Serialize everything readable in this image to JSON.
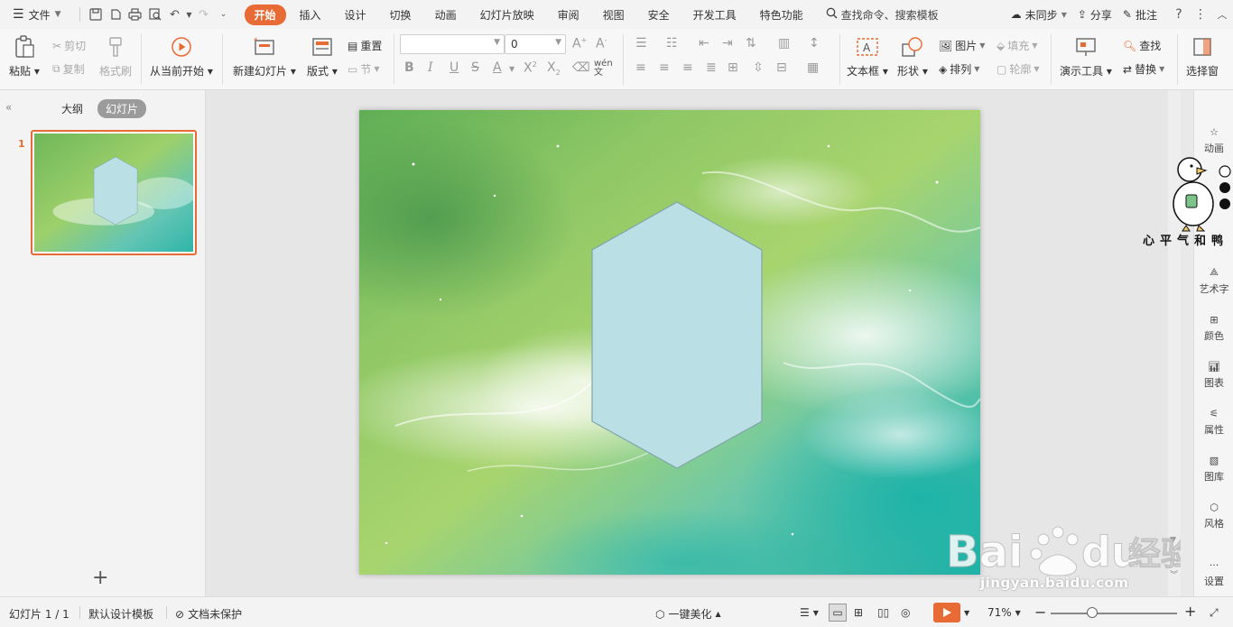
{
  "menu": {
    "file_label": "文件",
    "tabs": [
      "开始",
      "插入",
      "设计",
      "切换",
      "动画",
      "幻灯片放映",
      "审阅",
      "视图",
      "安全",
      "开发工具",
      "特色功能"
    ],
    "active_tab": "开始",
    "search_label": "查找命令、搜索模板",
    "sync_label": "未同步",
    "share_label": "分享",
    "comment_label": "批注",
    "help_label": "?"
  },
  "ribbon": {
    "paste": "粘贴",
    "cut": "剪切",
    "copy": "复制",
    "format_painter": "格式刷",
    "from_current": "从当前开始",
    "new_slide": "新建幻灯片",
    "layout": "版式",
    "reset": "重置",
    "section": "节",
    "font_name": "",
    "font_size": "0",
    "textbox": "文本框",
    "shape": "形状",
    "picture": "图片",
    "fill": "填充",
    "arrange": "排列",
    "outline": "轮廓",
    "present_tools": "演示工具",
    "find": "查找",
    "replace": "替换",
    "select_pane": "选择窗"
  },
  "left_panel": {
    "tab_outline": "大纲",
    "tab_slides": "幻灯片",
    "slide_number": "1",
    "add_symbol": "+"
  },
  "right_panel": {
    "items": [
      "动画",
      "艺术字",
      "颜色",
      "图表",
      "属性",
      "图库",
      "风格",
      "设置"
    ]
  },
  "watermarks": {
    "duck_text": "心平气和鸭",
    "baidu_logo": "Bai du 经验",
    "baidu_url": "jingyan.baidu.com"
  },
  "status": {
    "slide_count": "幻灯片 1 / 1",
    "template": "默认设计模板",
    "protect": "文档未保护",
    "beautify": "一键美化",
    "zoom": "71%"
  },
  "colors": {
    "accent": "#e86a34",
    "hexagon_fill": "#badfe4",
    "hexagon_stroke": "#7fa5aa"
  }
}
